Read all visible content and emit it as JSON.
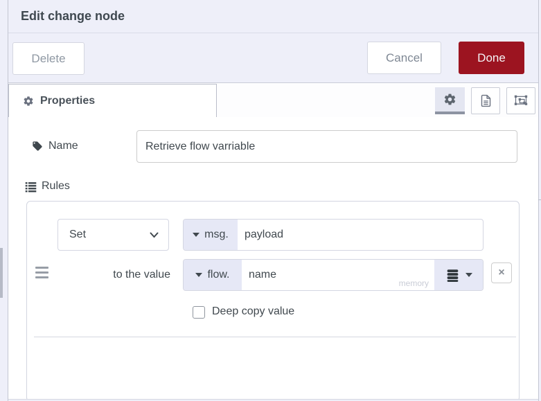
{
  "window": {
    "title": "Edit change node"
  },
  "toolbar": {
    "delete": "Delete",
    "cancel": "Cancel",
    "done": "Done"
  },
  "tabs": {
    "properties": "Properties"
  },
  "form": {
    "name": {
      "label": "Name",
      "value": "Retrieve flow varriable"
    },
    "rules": {
      "label": "Rules",
      "rule": {
        "action": "Set",
        "target_prefix": "msg.",
        "target": "payload",
        "to_label": "to the value",
        "value_prefix": "flow.",
        "value": "name",
        "store_hint": "memory",
        "deep_copy": "Deep copy value",
        "remove": "×"
      }
    }
  },
  "icons": {
    "tab": "gear-icon",
    "header_buttons": [
      "gear-icon",
      "file-icon",
      "group-icon"
    ],
    "name": "tag-icon",
    "rules": "list-icon",
    "store": "database-icon",
    "drag": "drag-handle-icon"
  },
  "colors": {
    "background": "#eeeff9",
    "accent_red": "#9c1420",
    "chip_lavender": "#e6e8f6",
    "border": "#d2d5e0",
    "text": "#40484e"
  }
}
